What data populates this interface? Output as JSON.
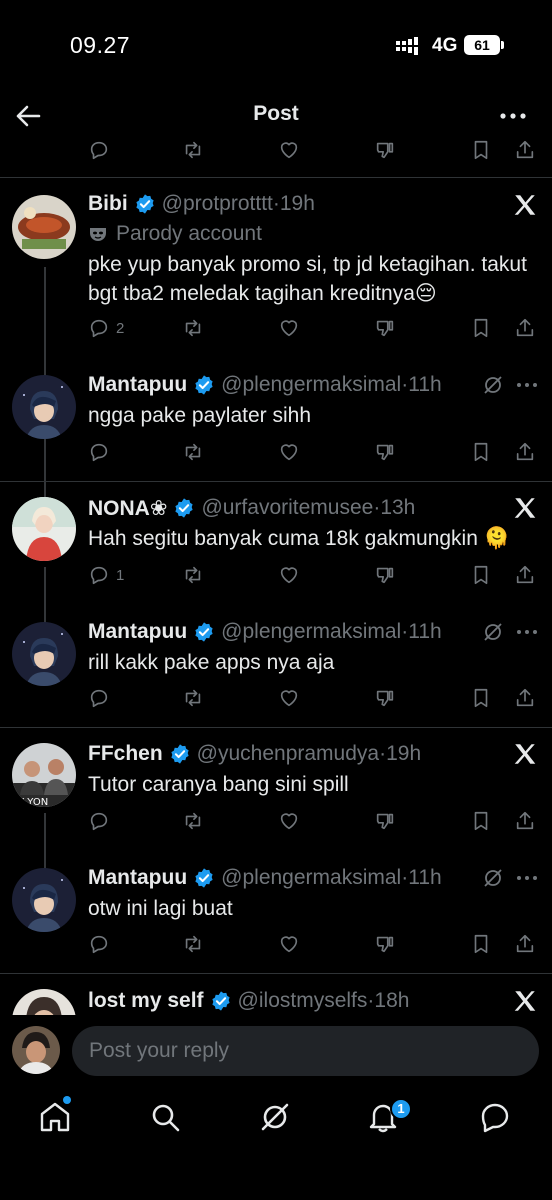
{
  "status_bar": {
    "time": "09.27",
    "network": "4G",
    "battery": "61"
  },
  "header": {
    "title": "Post"
  },
  "tweets": [
    {
      "name": "Bibi",
      "handle": "@protprotttt",
      "time": "19h",
      "badge": "Parody account",
      "text": "pke yup banyak promo si, tp jd ketagihan. takut bgt tba2 meledak tagihan kreditnya😔",
      "reply_count": "2"
    },
    {
      "name": "Mantapuu",
      "handle": "@plengermaksimal",
      "time": "11h",
      "text": "ngga pake paylater sihh",
      "reply_count": ""
    },
    {
      "name": "NONA❀",
      "handle": "@urfavoritemusee",
      "time": "13h",
      "text": "Hah segitu banyak cuma 18k gakmungkin 🫠",
      "reply_count": "1"
    },
    {
      "name": "Mantapuu",
      "handle": "@plengermaksimal",
      "time": "11h",
      "text": "rill kakk pake apps nya aja",
      "reply_count": ""
    },
    {
      "name": "FFchen",
      "handle": "@yuchenpramudya",
      "time": "19h",
      "text": "Tutor caranya bang sini spill",
      "reply_count": ""
    },
    {
      "name": "Mantapuu",
      "handle": "@plengermaksimal",
      "time": "11h",
      "text": "otw ini lagi buat",
      "reply_count": ""
    },
    {
      "name": "lost my self",
      "handle": "@ilostmyselfs",
      "time": "18h"
    }
  ],
  "composer": {
    "placeholder": "Post your reply"
  },
  "nav": {
    "notifications_badge": "1"
  },
  "colors": {
    "accent": "#1d9bf0",
    "muted": "#71767b",
    "text": "#e7e9ea",
    "background": "#000000"
  }
}
